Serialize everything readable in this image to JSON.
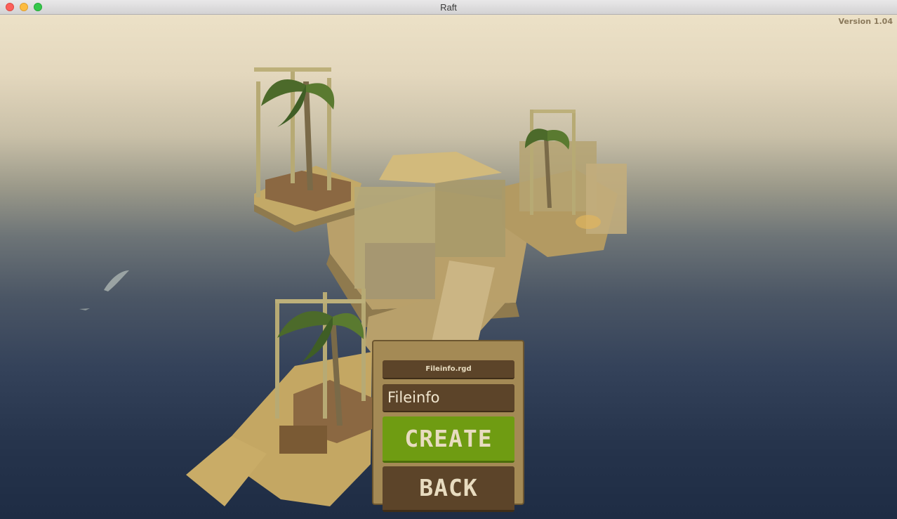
{
  "window": {
    "title": "Raft"
  },
  "hud": {
    "version": "Version 1.04"
  },
  "menu": {
    "file_header": "Fileinfo.rgd",
    "name_input_value": "Fileinfo",
    "create_label": "CREATE",
    "back_label": "BACK"
  },
  "colors": {
    "panel": "#a48a55",
    "panel_dark": "#5c4429",
    "create_green": "#6f9c12",
    "button_text": "#e8dcc0"
  }
}
